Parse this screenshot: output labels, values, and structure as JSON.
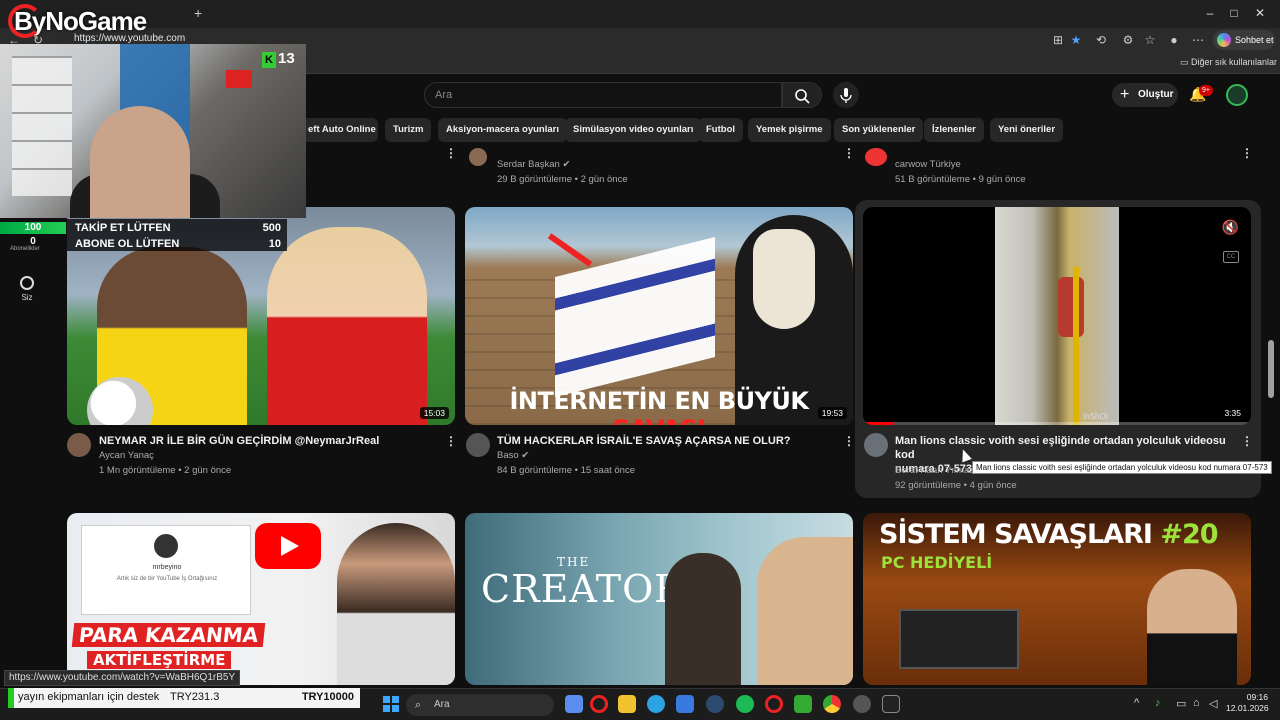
{
  "browser": {
    "url": "https://www.youtube.com",
    "chat_label": "Sohbet et",
    "favorites_label": "Diğer sık kullanılanlar",
    "window_controls": [
      "minimize-icon",
      "maximize-icon",
      "close-icon"
    ]
  },
  "overlay": {
    "brand": "ByNoGame",
    "cam_counter": "13",
    "score_top": "100",
    "score_bottom": "0"
  },
  "youtube": {
    "search_placeholder": "Ara",
    "create_label": "Oluştur",
    "notification_badge": "9+",
    "sidebar_you_label": "Siz",
    "sidebar_subs_label": "Abonelikler",
    "chips": [
      "eft Auto Online",
      "Turizm",
      "Aksiyon-macera oyunları",
      "Simülasyon video oyunları",
      "Futbol",
      "Yemek pişirme",
      "Son yüklenenler",
      "İzlenenler",
      "Yeni öneriler"
    ]
  },
  "row_top": [
    {
      "channel": "Serdar Başkan",
      "views": "29 B görüntüleme • 2 gün önce"
    },
    {
      "channel": "carwow Türkiye",
      "views": "51 B görüntüleme • 9 gün önce"
    }
  ],
  "videos": [
    {
      "title": "NEYMAR JR İLE BİR GÜN GEÇİRDİM @NeymarJrReal",
      "channel": "Aycan Yanaç",
      "views": "1 Mn görüntüleme • 2 gün önce",
      "duration": "15:03",
      "overlay_rows": [
        {
          "label": "TAKİP ET LÜTFEN",
          "value": "500"
        },
        {
          "label": "ABONE OL LÜTFEN",
          "value": "10"
        }
      ]
    },
    {
      "title": "TÜM HACKERLAR İSRAİL'E SAVAŞ AÇARSA NE OLUR?",
      "channel": "Baso",
      "views": "84 B görüntüleme • 15 saat önce",
      "duration": "19:53",
      "thumb_text_white": "İNTERNETİN EN BÜYÜK ",
      "thumb_text_red": "SAVAŞI"
    },
    {
      "title": "Man lions classic voith sesi eşliğinde ortadan yolculuk videosu kod numara 07-573",
      "title_line1": "Man lions classic voith sesi eşliğinde ortadan yolculuk videosu kod",
      "title_line2": "numara 07-573",
      "channel": "Berat Kaan Yılmaz",
      "views": "92 görüntüleme • 4 gün önce",
      "duration": "3:35",
      "watermark": "InShOt",
      "cc": "CC",
      "progress_fraction": 0.08
    }
  ],
  "row_bottom": [
    {
      "caption1": "PARA KAZANMA",
      "caption2": "AKTİFLEŞTİRME",
      "card_name": "mrbeyino",
      "card_sub": "Artık siz de bir YouTube İş Ortağısınız"
    },
    {
      "the": "THE",
      "word": "CREATOR"
    },
    {
      "head": "SİSTEM SAVAŞLARI ",
      "num": "#20",
      "sub": "PC HEDİYELİ"
    }
  ],
  "tooltip": "Man lions classic voith sesi eşliğinde ortadan yolculuk videosu kod numara 07-573",
  "status_url": "https://www.youtube.com/watch?v=WaBH6Q1rB5Y",
  "donation": {
    "text": "yayın ekipmanları için destek",
    "current": "TRY231.3",
    "goal": "TRY10000"
  },
  "taskbar": {
    "search_label": "Ara",
    "time": "09:16",
    "date": "12.01.2026"
  },
  "colors": {
    "accent_red": "#ff0000",
    "donation_green": "#22cc22",
    "chip_bg": "#272727"
  }
}
